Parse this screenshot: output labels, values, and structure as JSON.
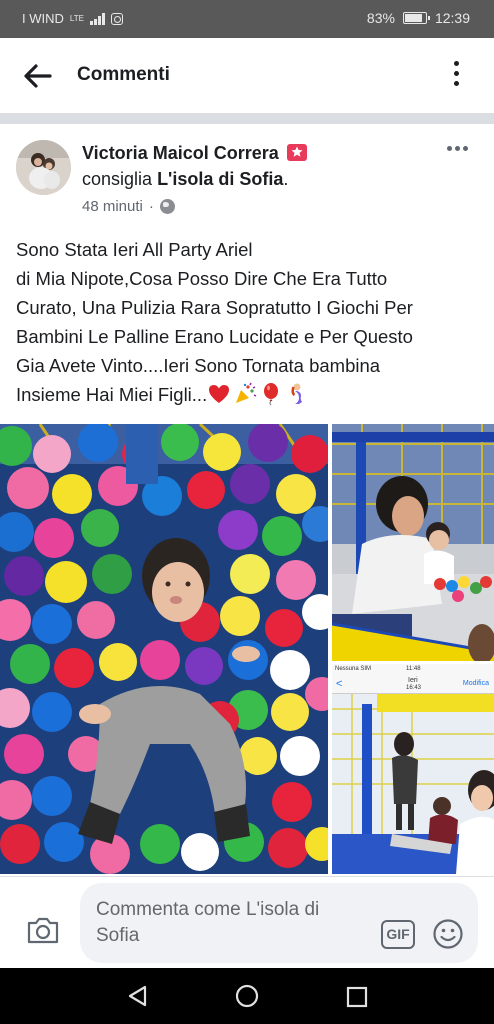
{
  "status_bar": {
    "carrier": "I WIND",
    "network": "LTE",
    "battery": "83%",
    "battery_level": 0.83,
    "time": "12:39"
  },
  "header": {
    "title": "Commenti"
  },
  "post": {
    "author": "Victoria Maicol Correra",
    "recommends": "consiglia",
    "page_name": "L'isola di Sofia",
    "time_ago": "48 minuti",
    "separator": "·",
    "text_lines": [
      "Sono Stata Ieri All Party Ariel",
      "di Mia Nipote,Cosa Posso Dire Che Era Tutto",
      "Curato, Una Pulizia Rara Sopratutto I Giochi Per",
      "Bambini Le Palline Erano Lucidate e Per Questo",
      "Gia Avete Vinto....Ieri Sono Tornata bambina",
      "Insieme Hai Miei Figli..."
    ],
    "emoji": [
      "red-heart",
      "party-popper",
      "balloon",
      "mermaid"
    ],
    "photos": [
      {
        "name": "ball-pit-photo"
      },
      {
        "name": "playground-photo"
      },
      {
        "name": "playground-screenshot-photo",
        "phone_carrier": "Nessuna SIM",
        "phone_time": "11:48",
        "phone_back": "<",
        "phone_title": "Ieri",
        "phone_subtitle": "16:43",
        "phone_edit": "Modifica"
      }
    ]
  },
  "comment": {
    "placeholder_line1": "Commenta come L'isola di",
    "placeholder_line2": "Sofia",
    "gif_label": "GIF"
  },
  "colors": {
    "accent_star": "#e83a5b",
    "text": "#1c1e21",
    "secondary": "#606770"
  }
}
